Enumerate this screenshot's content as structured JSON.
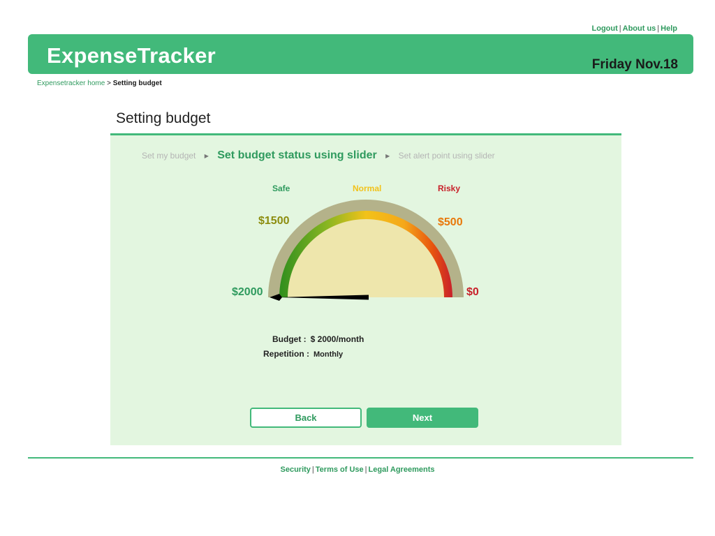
{
  "top_links": {
    "logout": "Logout",
    "about": "About us",
    "help": "Help",
    "separator": "|"
  },
  "header": {
    "brand": "ExpenseTracker",
    "date": "Friday Nov.18"
  },
  "breadcrumb": {
    "home": "Expensetracker home",
    "separator": ">",
    "current": "Setting budget"
  },
  "page": {
    "title": "Setting budget"
  },
  "steps": {
    "step1": "Set my budget",
    "step2": "Set budget status using slider",
    "step3": "Set alert point using slider",
    "arrow": "▶"
  },
  "gauge": {
    "zones": {
      "safe": "Safe",
      "normal": "Normal",
      "risky": "Risky"
    },
    "labels": {
      "max": "$2000",
      "high": "$1500",
      "low": "$500",
      "zero": "$0"
    },
    "range": [
      0,
      2000
    ],
    "needle_value": 2000,
    "colors": {
      "safe": "#2f9a5e",
      "normal": "#f2c21a",
      "risky": "#c8202a",
      "high_label": "#8c8c0e",
      "low_label": "#e8780a",
      "outer_ring": "#b4b28a",
      "inner_face": "#eee6ac"
    }
  },
  "budget": {
    "budget_label": "Budget :",
    "budget_value": "$ 2000/month",
    "repetition_label": "Repetition :",
    "repetition_value": "Monthly"
  },
  "buttons": {
    "back": "Back",
    "next": "Next"
  },
  "footer": {
    "security": "Security",
    "terms": "Terms of Use",
    "legal": "Legal Agreements",
    "separator": "|"
  },
  "theme": {
    "accent": "#42b97a",
    "panel_bg": "#e3f6e0"
  }
}
